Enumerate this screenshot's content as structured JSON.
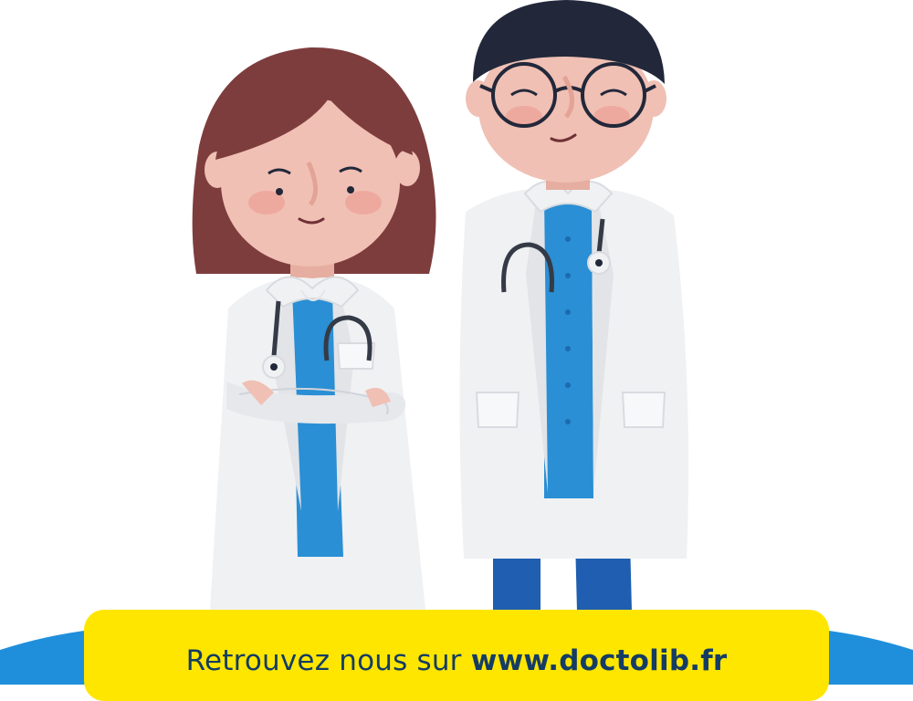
{
  "banner": {
    "text_prefix": "Retrouvez nous sur ",
    "text_link": "www.doctolib.fr"
  },
  "colors": {
    "background": "#ffffff",
    "banner_yellow": "#ffe600",
    "banner_text": "#143c64",
    "wave_blue": "#1f8fdc",
    "coat_white": "#f0f1f3",
    "shirt_blue": "#2a8fd4",
    "hair_female": "#7e3d3d",
    "hair_male": "#22283a",
    "skin": "#f0c0b4"
  },
  "illustration": {
    "left_figure": "female-doctor-with-stethoscope",
    "right_figure": "male-doctor-with-glasses-and-stethoscope"
  }
}
